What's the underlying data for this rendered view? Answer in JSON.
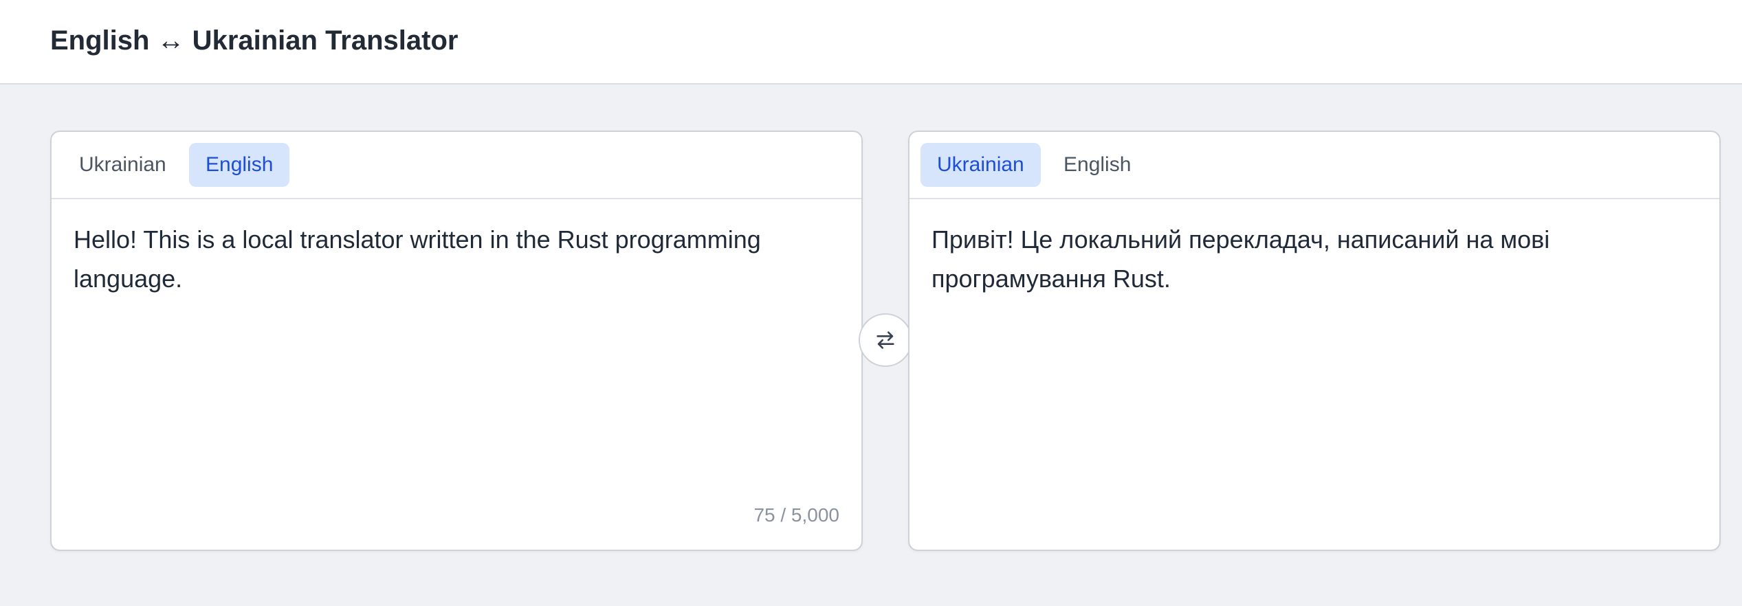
{
  "header": {
    "title": "English ↔ Ukrainian Translator"
  },
  "source_panel": {
    "tabs": [
      {
        "label": "Ukrainian",
        "active": false
      },
      {
        "label": "English",
        "active": true
      }
    ],
    "text": "Hello! This is a local translator written in the Rust programming language.",
    "char_count": "75 / 5,000"
  },
  "swap": {
    "icon": "swap-arrows-icon"
  },
  "target_panel": {
    "tabs": [
      {
        "label": "Ukrainian",
        "active": true
      },
      {
        "label": "English",
        "active": false
      }
    ],
    "text": "Привіт! Це локальний перекладач, написаний на мові програмування Rust."
  },
  "colors": {
    "accent": "#1d4ed8",
    "active_tab_bg": "#d6e4fc",
    "page_bg": "#eff1f5"
  }
}
